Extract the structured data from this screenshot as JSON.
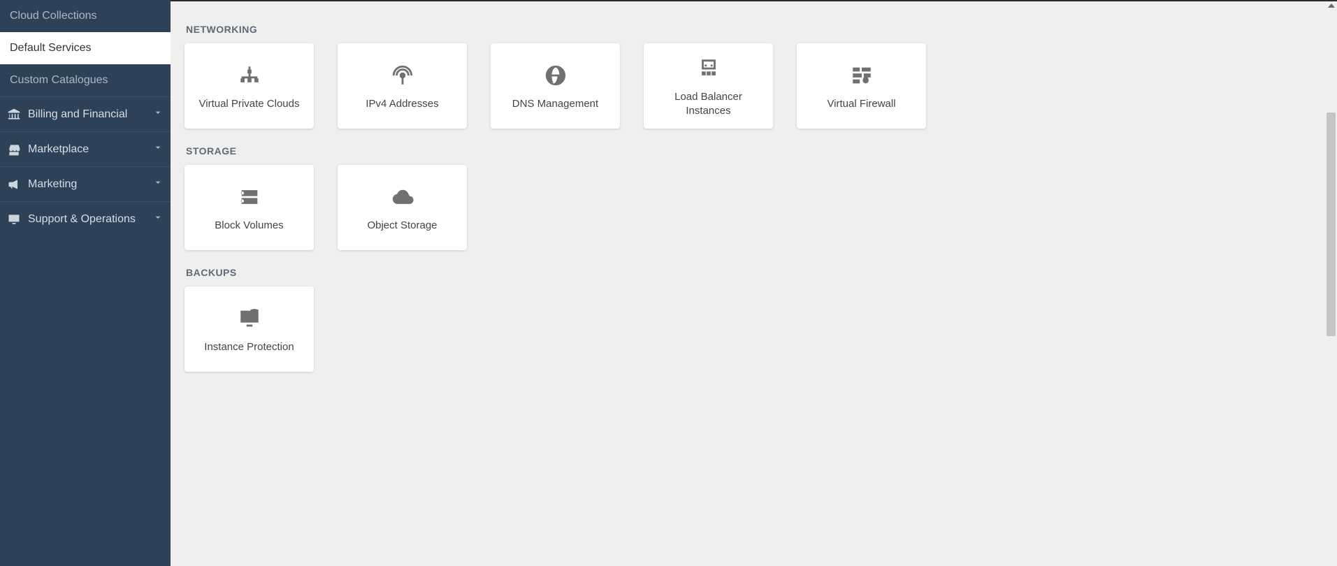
{
  "sidebar": {
    "submenu": [
      {
        "label": "Cloud Collections",
        "active": false
      },
      {
        "label": "Default Services",
        "active": true
      },
      {
        "label": "Custom Catalogues",
        "active": false
      }
    ],
    "groups": [
      {
        "label": "Billing and Financial",
        "icon": "bank"
      },
      {
        "label": "Marketplace",
        "icon": "store"
      },
      {
        "label": "Marketing",
        "icon": "megaphone"
      },
      {
        "label": "Support & Operations",
        "icon": "monitor"
      }
    ]
  },
  "sections": [
    {
      "title": "NETWORKING",
      "cards": [
        {
          "label": "Virtual Private Clouds",
          "icon": "network"
        },
        {
          "label": "IPv4 Addresses",
          "icon": "broadcast"
        },
        {
          "label": "DNS Management",
          "icon": "globe"
        },
        {
          "label": "Load Balancer Instances",
          "icon": "loadbalancer"
        },
        {
          "label": "Virtual Firewall",
          "icon": "firewall"
        }
      ]
    },
    {
      "title": "STORAGE",
      "cards": [
        {
          "label": "Block Volumes",
          "icon": "disks"
        },
        {
          "label": "Object Storage",
          "icon": "cloudbox"
        }
      ]
    },
    {
      "title": "BACKUPS",
      "cards": [
        {
          "label": "Instance Protection",
          "icon": "monitorshield"
        }
      ]
    }
  ]
}
